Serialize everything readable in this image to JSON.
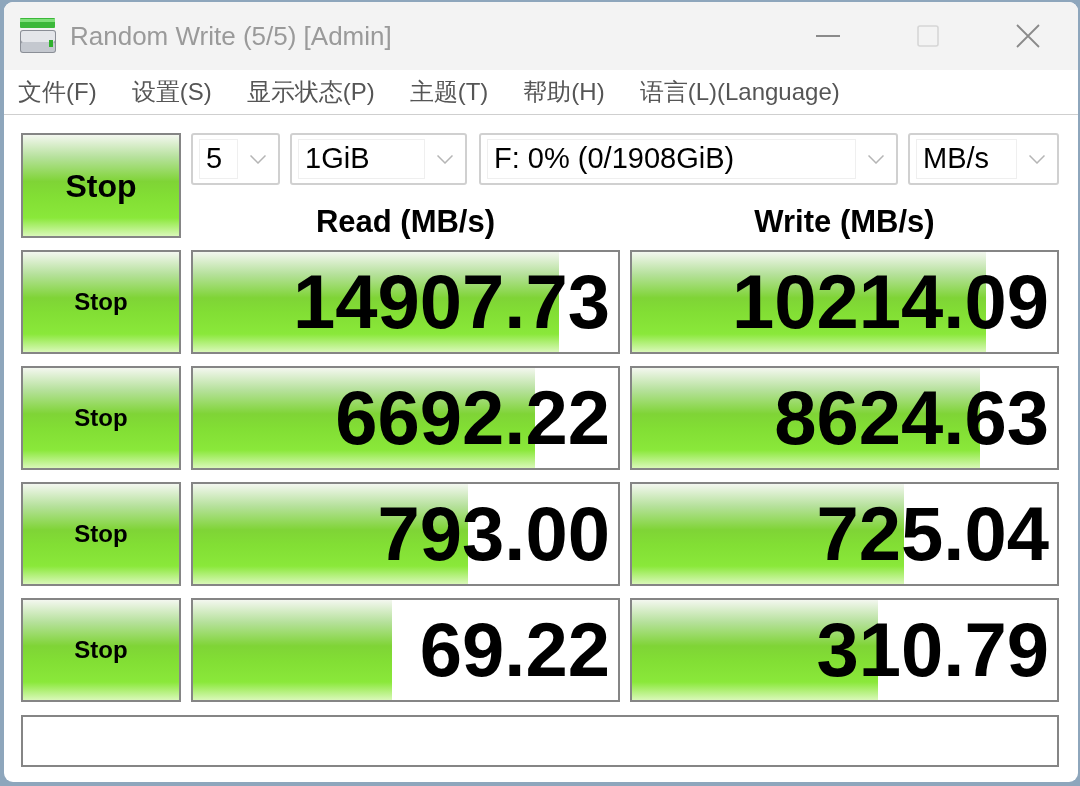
{
  "window": {
    "title": "Random Write (5/5) [Admin]",
    "active": false,
    "maximize_disabled": true
  },
  "menu": [
    "文件(F)",
    "设置(S)",
    "显示状态(P)",
    "主题(T)",
    "帮助(H)",
    "语言(L)(Language)"
  ],
  "all_button": {
    "label": "Stop"
  },
  "settings": [
    {
      "value": "5"
    },
    {
      "value": "1GiB"
    },
    {
      "value": "F: 0% (0/1908GiB)"
    },
    {
      "value": "MB/s"
    }
  ],
  "columns": [
    "Read (MB/s)",
    "Write (MB/s)"
  ],
  "tests": [
    {
      "button": "Stop",
      "read": {
        "value": "14907.73",
        "level": 0.86
      },
      "write": {
        "value": "10214.09",
        "level": 0.834
      }
    },
    {
      "button": "Stop",
      "read": {
        "value": "6692.22",
        "level": 0.804
      },
      "write": {
        "value": "8624.63",
        "level": 0.818
      }
    },
    {
      "button": "Stop",
      "read": {
        "value": "793.00",
        "level": 0.646
      },
      "write": {
        "value": "725.04",
        "level": 0.641
      }
    },
    {
      "button": "Stop",
      "read": {
        "value": "69.22",
        "level": 0.469
      },
      "write": {
        "value": "310.79",
        "level": 0.578
      }
    }
  ]
}
